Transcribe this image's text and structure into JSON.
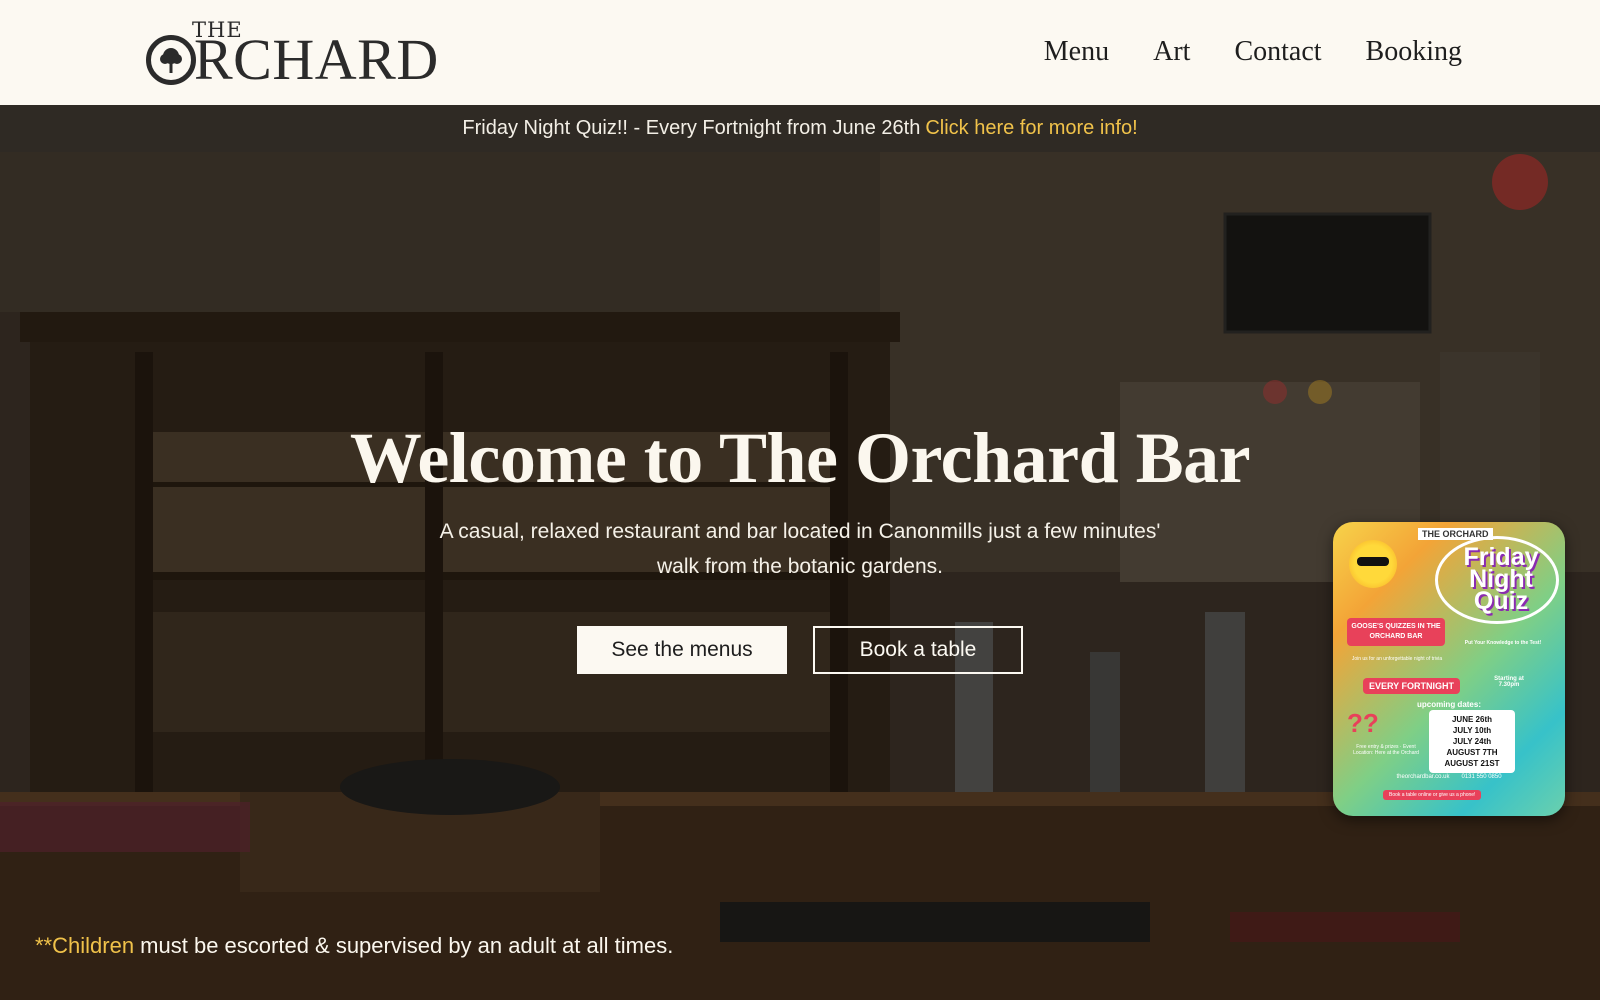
{
  "header": {
    "logo_the": "THE",
    "logo_rest": "RCHARD",
    "nav": [
      "Menu",
      "Art",
      "Contact",
      "Booking"
    ]
  },
  "announcement": {
    "text": "Friday Night Quiz!! - Every Fortnight from June 26th",
    "link": "Click here for more info!"
  },
  "hero": {
    "title": "Welcome to The Orchard Bar",
    "subtitle": "A casual, relaxed restaurant and bar located in Canonmills just a few minutes' walk from the botanic gardens.",
    "primary_button": "See the menus",
    "secondary_button": "Book a table"
  },
  "notice": {
    "highlight": "**Children",
    "text": " must be escorted & supervised by an adult at all times."
  },
  "poster": {
    "logo": "THE ORCHARD",
    "title_line1": "Friday",
    "title_line2": "Night",
    "title_line3": "Quiz",
    "tag": "GOOSE'S QUIZZES IN THE ORCHARD BAR",
    "put": "Put Your Knowledge to the Test!",
    "join": "Join us for an unforgettable night of trivia",
    "frequency": "EVERY FORTNIGHT",
    "start": "Starting at 7.30pm",
    "upcoming": "upcoming dates:",
    "dates": [
      "JUNE 26th",
      "JULY 10th",
      "JULY 24th",
      "AUGUST 7TH",
      "AUGUST 21ST"
    ],
    "free": "Free entry & prizes · Event Location: Here at the Orchard",
    "website": "theorchardbar.co.uk",
    "phone": "0131 550 0850",
    "book": "Book a table online or give us a phone!"
  },
  "colors": {
    "header_bg": "#fcf9f2",
    "announcement_bg": "#2f2a24",
    "accent": "#f0c24a"
  }
}
